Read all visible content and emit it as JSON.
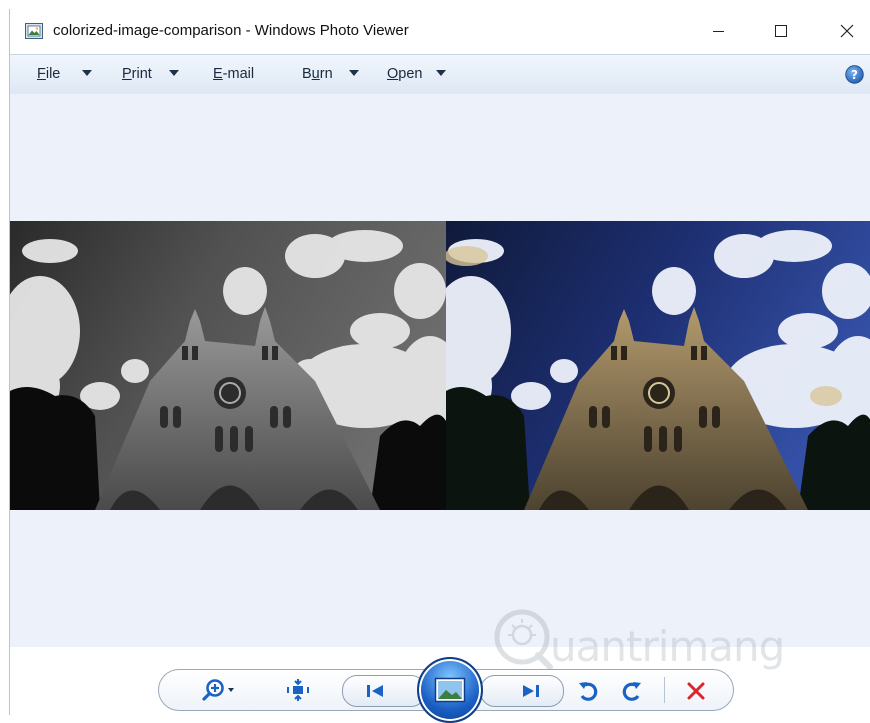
{
  "window": {
    "title": "colorized-image-comparison - Windows Photo Viewer",
    "icon": "photo-viewer-icon"
  },
  "menu": {
    "items": [
      {
        "label": "File",
        "mnemonic": "F",
        "rest": "ile"
      },
      {
        "label": "Print",
        "mnemonic": "P",
        "rest": "rint"
      },
      {
        "label": "E-mail",
        "mnemonic": "E",
        "rest": "-mail"
      },
      {
        "label": "Burn",
        "pre": "B",
        "mnemonic": "u",
        "rest": "rn"
      },
      {
        "label": "Open",
        "mnemonic": "O",
        "rest": "pen"
      }
    ],
    "help_icon": "help-icon"
  },
  "viewer": {
    "images": [
      {
        "name": "grayscale-church-photo",
        "tone": "grayscale"
      },
      {
        "name": "colorized-church-photo",
        "tone": "color"
      }
    ],
    "background": "#ecf1fa"
  },
  "toolbar": {
    "controls": [
      "zoom-icon",
      "actual-size-icon",
      "previous-icon",
      "slideshow-icon",
      "next-icon",
      "rotate-counterclockwise-icon",
      "rotate-clockwise-icon",
      "delete-icon"
    ]
  },
  "watermark": {
    "text": "uantrimang",
    "lead": "Q"
  },
  "colors": {
    "accent": "#1a63c4",
    "delete": "#d9262a",
    "menubar": "#dde8f5"
  }
}
